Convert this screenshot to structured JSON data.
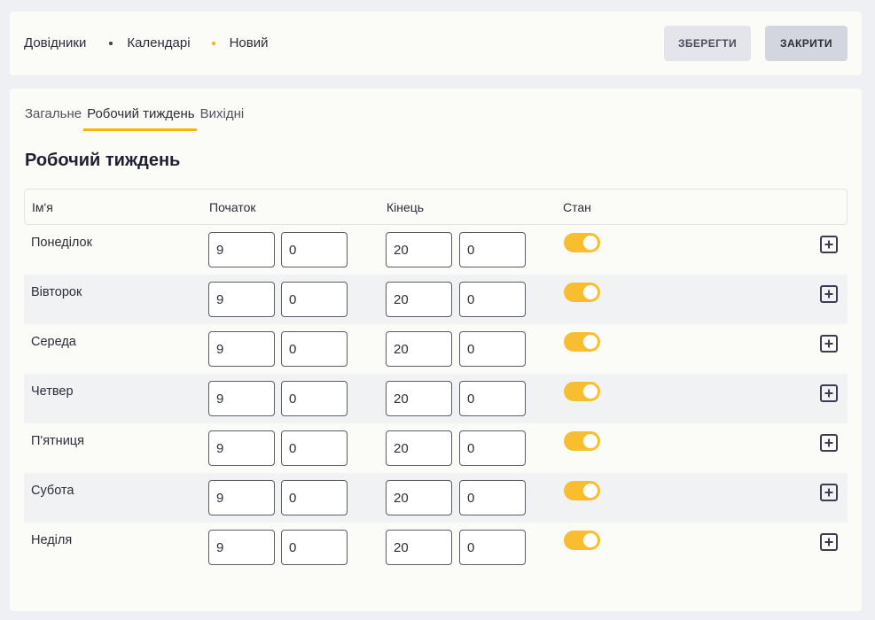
{
  "breadcrumb": [
    "Довідники",
    "Календарі",
    "Новий"
  ],
  "header": {
    "save_label": "ЗБЕРЕГТИ",
    "close_label": "ЗАКРИТИ"
  },
  "tabs": [
    "Загальне",
    "Робочий тиждень",
    "Вихідні"
  ],
  "active_tab": "Робочий тиждень",
  "section_title": "Робочий тиждень",
  "columns": {
    "name": "Ім'я",
    "start": "Початок",
    "end": "Кінець",
    "state": "Стан"
  },
  "rows": [
    {
      "day": "Понеділок",
      "start_h": "9",
      "start_m": "0",
      "end_h": "20",
      "end_m": "0",
      "enabled": true
    },
    {
      "day": "Вівторок",
      "start_h": "9",
      "start_m": "0",
      "end_h": "20",
      "end_m": "0",
      "enabled": true
    },
    {
      "day": "Середа",
      "start_h": "9",
      "start_m": "0",
      "end_h": "20",
      "end_m": "0",
      "enabled": true
    },
    {
      "day": "Четвер",
      "start_h": "9",
      "start_m": "0",
      "end_h": "20",
      "end_m": "0",
      "enabled": true
    },
    {
      "day": "П'ятниця",
      "start_h": "9",
      "start_m": "0",
      "end_h": "20",
      "end_m": "0",
      "enabled": true
    },
    {
      "day": "Субота",
      "start_h": "9",
      "start_m": "0",
      "end_h": "20",
      "end_m": "0",
      "enabled": true
    },
    {
      "day": "Неділя",
      "start_h": "9",
      "start_m": "0",
      "end_h": "20",
      "end_m": "0",
      "enabled": true
    }
  ],
  "colors": {
    "accent": "#f7b500",
    "toggle_on": "#f9be30",
    "background": "#eff0f4",
    "card": "#fbfbf8"
  },
  "icons": {
    "row_action": "plus-square-icon",
    "breadcrumb_separator": "dot-icon"
  }
}
